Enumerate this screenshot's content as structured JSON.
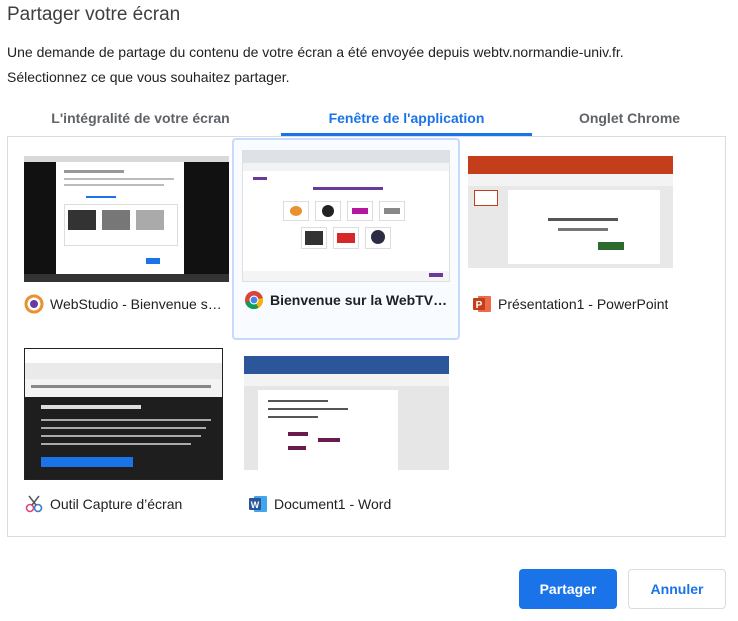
{
  "dialog": {
    "title": "Partager votre écran",
    "description_line1": "Une demande de partage du contenu de votre écran a été envoyée depuis webtv.normandie-univ.fr.",
    "description_line2": "Sélectionnez ce que vous souhaitez partager."
  },
  "tabs": [
    {
      "label": "L'intégralité de votre écran",
      "active": false
    },
    {
      "label": "Fenêtre de l'application",
      "active": true
    },
    {
      "label": "Onglet Chrome",
      "active": false
    }
  ],
  "windows": [
    {
      "label": "WebStudio - Bienvenue sur la WebTV",
      "icon": "webstudio-icon",
      "selected": false
    },
    {
      "label": "Bienvenue sur la WebTV Normandie Université",
      "icon": "chrome-icon",
      "selected": true
    },
    {
      "label": "Présentation1 - PowerPoint",
      "icon": "powerpoint-icon",
      "selected": false
    },
    {
      "label": "Outil Capture d’écran",
      "icon": "snipping-tool-icon",
      "selected": false
    },
    {
      "label": "Document1 - Word",
      "icon": "word-icon",
      "selected": false
    }
  ],
  "buttons": {
    "share": "Partager",
    "cancel": "Annuler"
  },
  "colors": {
    "accent": "#1a73e8",
    "selected_border": "#c6dafc",
    "powerpoint": "#d24726",
    "word": "#2b579a"
  }
}
